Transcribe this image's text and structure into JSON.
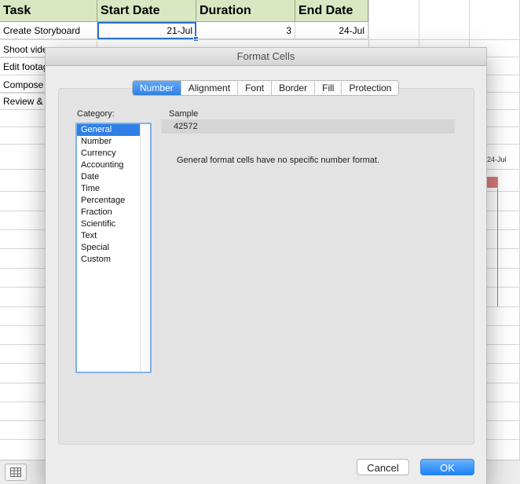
{
  "sheet": {
    "headers": [
      "Task",
      "Start Date",
      "Duration",
      "End Date"
    ],
    "rows": [
      {
        "task": "Create Storyboard",
        "start": "21-Jul",
        "duration": "3",
        "end": "24-Jul"
      },
      {
        "task": "Shoot vide"
      },
      {
        "task": "Edit footag"
      },
      {
        "task": "Compose"
      },
      {
        "task": "Review &"
      }
    ],
    "gantt_date_label": "24-Jul"
  },
  "dialog": {
    "title": "Format Cells",
    "tabs": [
      "Number",
      "Alignment",
      "Font",
      "Border",
      "Fill",
      "Protection"
    ],
    "active_tab": "Number",
    "category_label": "Category:",
    "categories": [
      "General",
      "Number",
      "Currency",
      "Accounting",
      "Date",
      "Time",
      "Percentage",
      "Fraction",
      "Scientific",
      "Text",
      "Special",
      "Custom"
    ],
    "selected_category": "General",
    "sample_label": "Sample",
    "sample_value": "42572",
    "description": "General format cells have no specific number format.",
    "cancel_label": "Cancel",
    "ok_label": "OK"
  },
  "colors": {
    "header_fill": "#d9e7c2",
    "accent": "#2f7fe7",
    "gantt_bar": "#d97a7a"
  }
}
